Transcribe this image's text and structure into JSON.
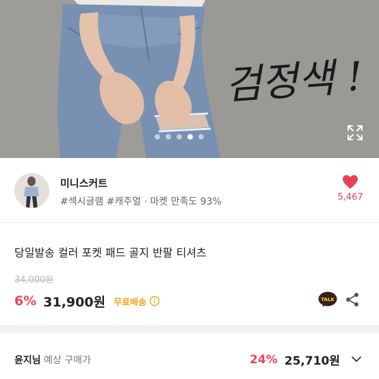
{
  "hero": {
    "handwritten_text": "검정색 !",
    "carousel": {
      "count": 5,
      "active_index": 3
    }
  },
  "seller": {
    "name": "미니스커트",
    "tags": "#섹시글램 #캐주얼 · 마켓 만족도 93%",
    "likes": "5,467"
  },
  "product": {
    "title": "당일발송 컬러 포켓 패드 골지 반팔 티셔츠",
    "original_price": "34,000원",
    "discount": "6%",
    "price": "31,900원",
    "shipping": "무료배송"
  },
  "member_price": {
    "name": "윤지님",
    "label": "예상 구매가",
    "discount": "24%",
    "price": "25,710원"
  },
  "colors": {
    "accent": "#f0445b",
    "heart": "#e8425a",
    "shipping": "#f7a21b",
    "kakao": "#3c1e1e"
  },
  "icons": [
    "expand-icon",
    "heart-icon",
    "info-icon",
    "kakaotalk-icon",
    "share-icon",
    "chevron-down-icon"
  ]
}
